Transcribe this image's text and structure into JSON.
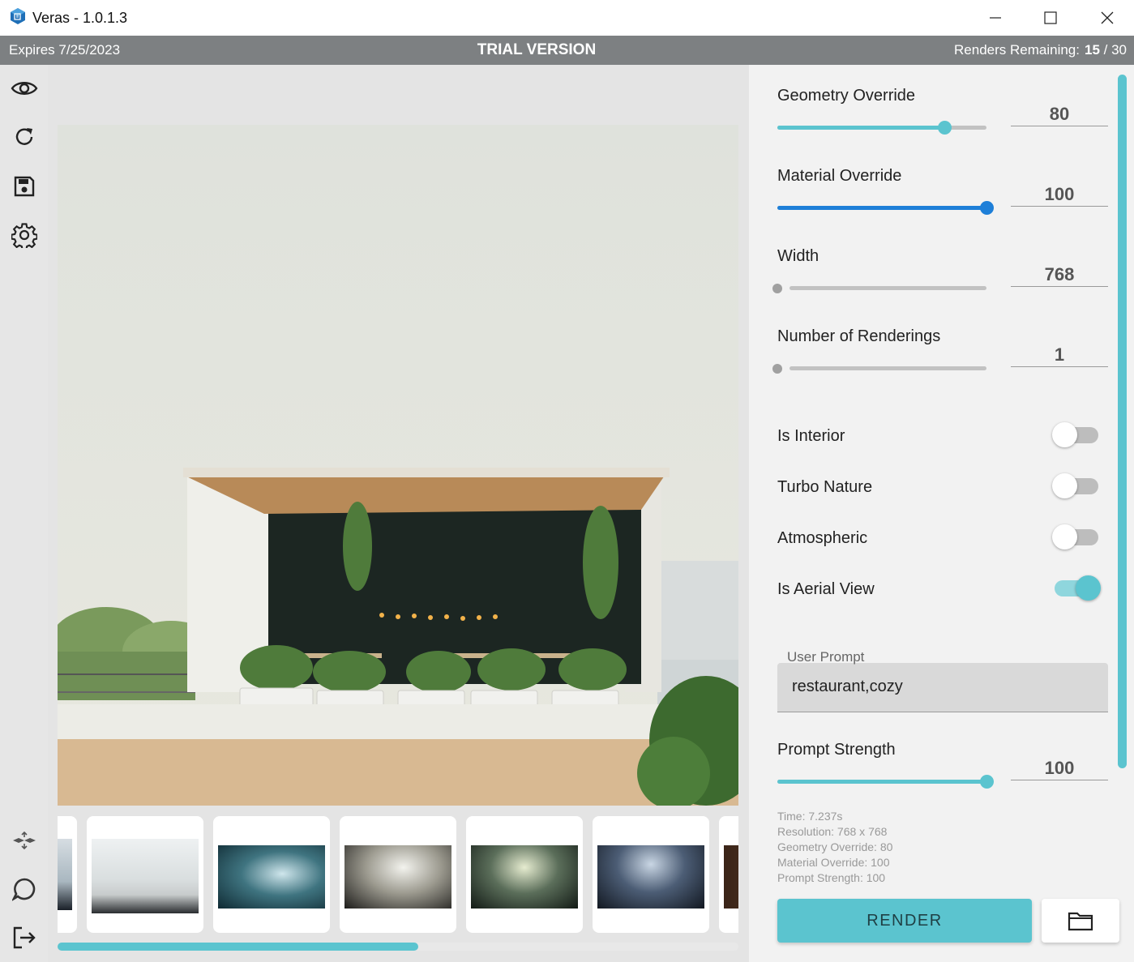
{
  "window": {
    "title": "Veras - 1.0.1.3",
    "icons": {
      "app": "veras-cube-icon",
      "minimize": "minimize-icon",
      "maximize": "maximize-icon",
      "close": "close-icon"
    }
  },
  "trial_bar": {
    "expires": "Expires 7/25/2023",
    "banner": "TRIAL VERSION",
    "renders_label": "Renders Remaining:",
    "renders_used": "15",
    "renders_total": "/ 30"
  },
  "left_rail": {
    "top_icons": [
      "eye-icon",
      "refresh-icon",
      "save-icon",
      "settings-gear-icon"
    ],
    "bottom_icons": [
      "vr-view-icon",
      "chat-icon",
      "logout-icon"
    ]
  },
  "settings": {
    "geometry_override": {
      "label": "Geometry Override",
      "value": "80",
      "fraction": 0.8
    },
    "material_override": {
      "label": "Material Override",
      "value": "100",
      "fraction": 1.0
    },
    "width": {
      "label": "Width",
      "value": "768",
      "fraction": 0.0
    },
    "num_renderings": {
      "label": "Number of Renderings",
      "value": "1",
      "fraction": 0.0
    },
    "is_interior": {
      "label": "Is Interior",
      "on": false
    },
    "turbo_nature": {
      "label": "Turbo Nature",
      "on": false
    },
    "atmospheric": {
      "label": "Atmospheric",
      "on": false
    },
    "is_aerial_view": {
      "label": "Is Aerial View",
      "on": true
    },
    "user_prompt": {
      "label": "User Prompt",
      "value": "restaurant,cozy"
    },
    "prompt_strength": {
      "label": "Prompt Strength",
      "value": "100",
      "fraction": 1.0
    }
  },
  "render_info": {
    "time": "Time: 7.237s",
    "resolution": "Resolution: 768 x 768",
    "geometry": "Geometry Override: 80",
    "material": "Material Override: 100",
    "prompt_strength": "Prompt Strength: 100"
  },
  "actions": {
    "render_label": "RENDER",
    "folder_icon": "folder-icon"
  },
  "gallery": {
    "scroll_fraction": 0.53
  },
  "colors": {
    "accent": "#5bc4cf",
    "active_slider": "#1e7fd8",
    "trial_bar": "#7d8082"
  }
}
